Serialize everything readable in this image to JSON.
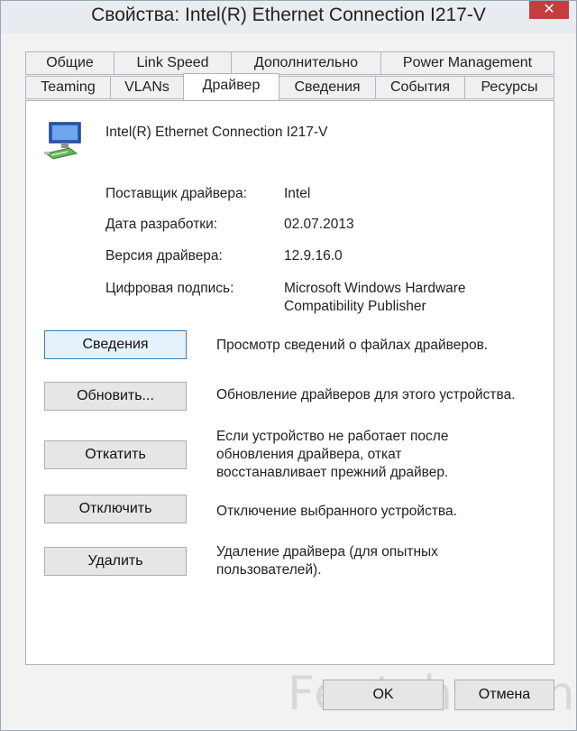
{
  "window": {
    "title": "Свойства: Intel(R) Ethernet Connection I217-V",
    "close_glyph": "✕"
  },
  "tabs_row1": [
    "Общие",
    "Link Speed",
    "Дополнительно",
    "Power Management"
  ],
  "tabs_row2": [
    "Teaming",
    "VLANs",
    "Драйвер",
    "Сведения",
    "События",
    "Ресурсы"
  ],
  "active_tab": "Драйвер",
  "device": {
    "name": "Intel(R) Ethernet Connection I217-V",
    "icon": "network-adapter-icon"
  },
  "info": {
    "provider_label": "Поставщик драйвера:",
    "provider_value": "Intel",
    "date_label": "Дата разработки:",
    "date_value": "02.07.2013",
    "version_label": "Версия драйвера:",
    "version_value": "12.9.16.0",
    "signer_label": "Цифровая подпись:",
    "signer_value_line1": "Microsoft Windows Hardware",
    "signer_value_line2": "Compatibility Publisher"
  },
  "actions": {
    "details_label": "Сведения",
    "details_desc": "Просмотр сведений о файлах драйверов.",
    "update_label": "Обновить...",
    "update_desc": "Обновление драйверов для этого устройства.",
    "rollback_label": "Откатить",
    "rollback_desc_line1": "Если устройство не работает после",
    "rollback_desc_line2": "обновления драйвера, откат",
    "rollback_desc_line3": "восстанавливает прежний драйвер.",
    "disable_label": "Отключить",
    "disable_desc": "Отключение выбранного устройства.",
    "uninstall_label": "Удалить",
    "uninstall_desc_line1": "Удаление драйвера (для опытных",
    "uninstall_desc_line2": "пользователей)."
  },
  "footer": {
    "ok_label": "OK",
    "cancel_label": "Отмена"
  },
  "watermark": "Feetch.com"
}
